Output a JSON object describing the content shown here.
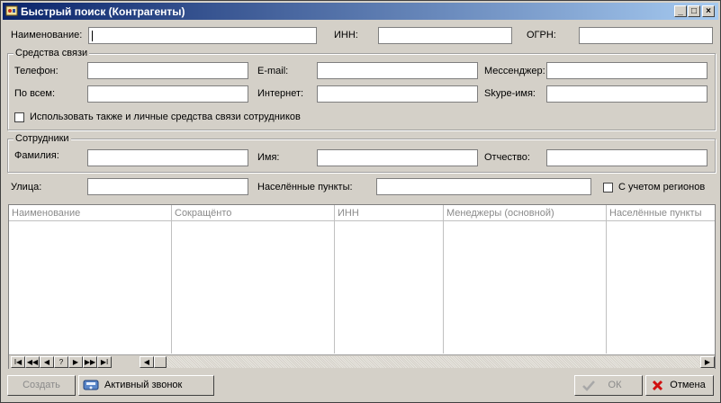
{
  "window": {
    "title": "Быстрый поиск (Контрагенты)",
    "controls": [
      "_",
      "□",
      "×"
    ]
  },
  "fields": {
    "name_label": "Наименование:",
    "inn_label": "ИНН:",
    "ogrn_label": "ОГРН:"
  },
  "contacts": {
    "group_label": "Средства связи",
    "phone_label": "Телефон:",
    "email_label": "E-mail:",
    "messenger_label": "Мессенджер:",
    "any_label": "По всем:",
    "internet_label": "Интернет:",
    "skype_label": "Skype-имя:",
    "also_personal_label": "Использовать также и личные средства связи сотрудников"
  },
  "employees": {
    "group_label": "Сотрудники",
    "surname_label": "Фамилия:",
    "firstname_label": "Имя:",
    "patronymic_label": "Отчество:"
  },
  "address": {
    "street_label": "Улица:",
    "settlements_label": "Населённые пункты:",
    "regions_label": "С учетом регионов"
  },
  "grid": {
    "columns": [
      "Наименование",
      "Сокращёнто",
      "ИНН",
      "Менеджеры (основной)",
      "Населённые пункты"
    ],
    "nav": [
      "I◀",
      "◀◀",
      "◀",
      "?",
      "▶",
      "▶▶",
      "▶I"
    ]
  },
  "buttons": {
    "create": "Создать",
    "active_call": "Активный звонок",
    "ok": "ОК",
    "cancel": "Отмена"
  }
}
